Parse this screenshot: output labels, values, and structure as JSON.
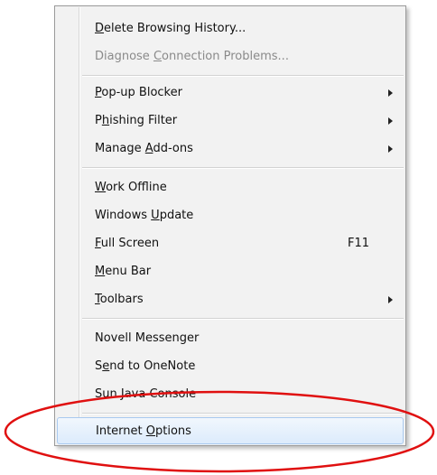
{
  "menu": {
    "items": [
      {
        "pre": "",
        "key": "D",
        "post": "elete Browsing History...",
        "disabled": false
      },
      {
        "pre": "Diagnose ",
        "key": "C",
        "post": "onnection Problems...",
        "disabled": true
      },
      {
        "pre": "",
        "key": "P",
        "post": "op-up Blocker",
        "submenu": true
      },
      {
        "pre": "P",
        "key": "h",
        "post": "ishing Filter",
        "submenu": true
      },
      {
        "pre": "Manage ",
        "key": "A",
        "post": "dd-ons",
        "submenu": true
      },
      {
        "pre": "",
        "key": "W",
        "post": "ork Offline"
      },
      {
        "pre": "Windows ",
        "key": "U",
        "post": "pdate"
      },
      {
        "pre": "",
        "key": "F",
        "post": "ull Screen",
        "shortcut": "F11"
      },
      {
        "pre": "",
        "key": "M",
        "post": "enu Bar"
      },
      {
        "pre": "",
        "key": "T",
        "post": "oolbars",
        "submenu": true
      },
      {
        "pre": "Novell Messenger",
        "key": "",
        "post": ""
      },
      {
        "pre": "S",
        "key": "e",
        "post": "nd to OneNote"
      },
      {
        "pre": "Sun Java Console",
        "key": "",
        "post": ""
      },
      {
        "pre": "Internet ",
        "key": "O",
        "post": "ptions",
        "highlighted": true
      }
    ]
  },
  "annotation": {
    "color": "#e01010",
    "shape": "ellipse"
  }
}
